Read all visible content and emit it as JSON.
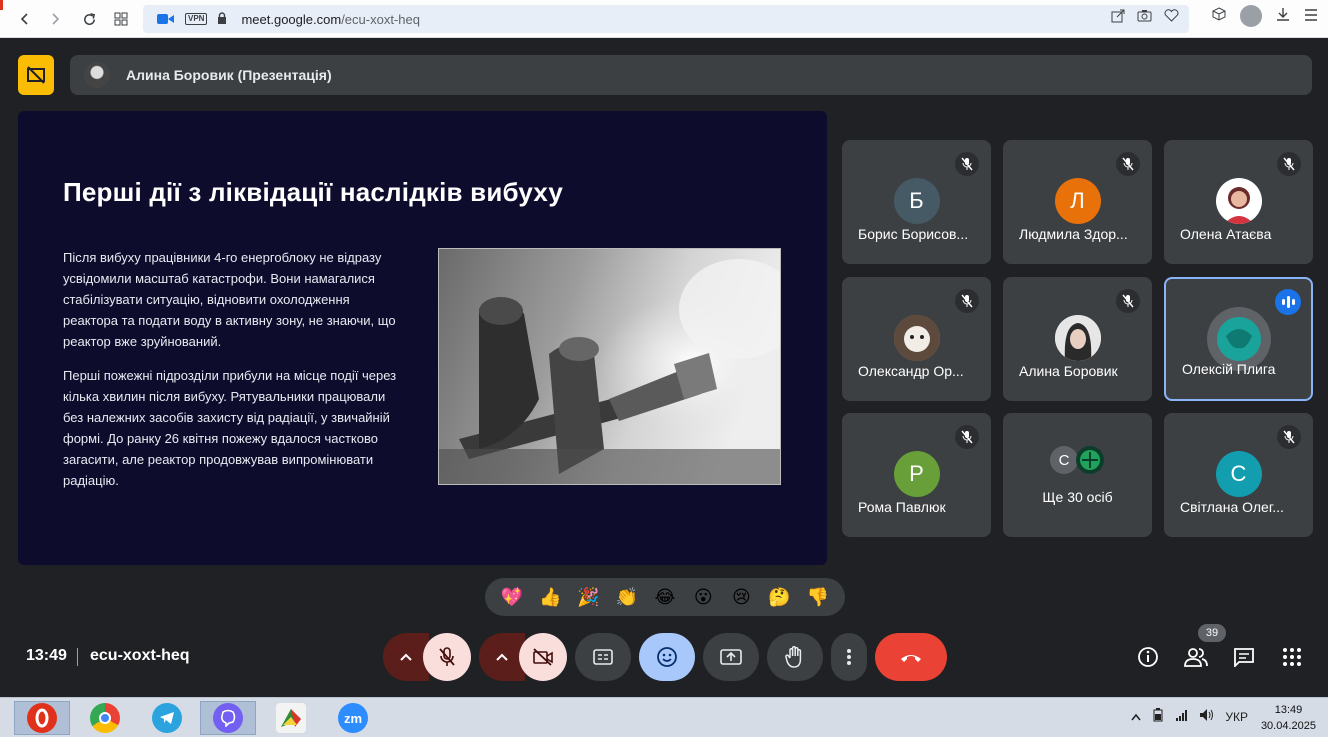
{
  "browser": {
    "url_host": "meet.google.com",
    "url_path": "/ecu-xoxt-heq",
    "vpn_label": "VPN"
  },
  "header": {
    "presenter_label": "Алина Боровик (Презентація)"
  },
  "slide": {
    "title": "Перші дії з ліквідації наслідків вибуху",
    "paragraph1": "Після вибуху працівники 4-го енергоблоку не відразу усвідомили масштаб катастрофи. Вони намагалися стабілізувати ситуацію, відновити охолодження реактора та подати воду в активну зону, не знаючи, що реактор вже зруйнований.",
    "paragraph2": "Перші пожежні підрозділи прибули на місце події через кілька хвилин після вибуху. Рятувальники працювали без належних засобів захисту від радіації, у звичайній формі. До ранку 26 квітня пожежу вдалося частково загасити, але реактор продовжував випромінювати радіацію."
  },
  "participants": [
    {
      "name": "Борис Борисов...",
      "initial": "Б",
      "color": "#455a64",
      "muted": true
    },
    {
      "name": "Людмила Здор...",
      "initial": "Л",
      "color": "#e8710a",
      "muted": true
    },
    {
      "name": "Олена Атаєва",
      "initial": "",
      "color": "#ffffff",
      "muted": true
    },
    {
      "name": "Олександр Ор...",
      "initial": "",
      "color": "#9c8c7a",
      "muted": true
    },
    {
      "name": "Алина Боровик",
      "initial": "",
      "color": "#cfcfcf",
      "muted": true
    },
    {
      "name": "Олексій Плига",
      "initial": "",
      "color": "#1aa39a",
      "muted": false
    },
    {
      "name": "Рома Павлюк",
      "initial": "Р",
      "color": "#689f38",
      "muted": true
    },
    {
      "name": "Ще 30 осіб",
      "initial": "С",
      "color": "#5f6368",
      "muted": false
    },
    {
      "name": "Світлана Олег...",
      "initial": "С",
      "color": "#129eaf",
      "muted": true
    }
  ],
  "reactions": [
    "💖",
    "👍",
    "🎉",
    "👏",
    "😂",
    "😮",
    "😢",
    "🤔",
    "👎"
  ],
  "footer": {
    "time": "13:49",
    "meeting_code": "ecu-xoxt-heq",
    "participant_count": "39"
  },
  "taskbar": {
    "lang": "УКР",
    "clock_time": "13:49",
    "clock_date": "30.04.2025",
    "apps": [
      "opera",
      "chrome",
      "telegram",
      "viber",
      "app",
      "zoom"
    ],
    "zoom_label": "zm"
  }
}
